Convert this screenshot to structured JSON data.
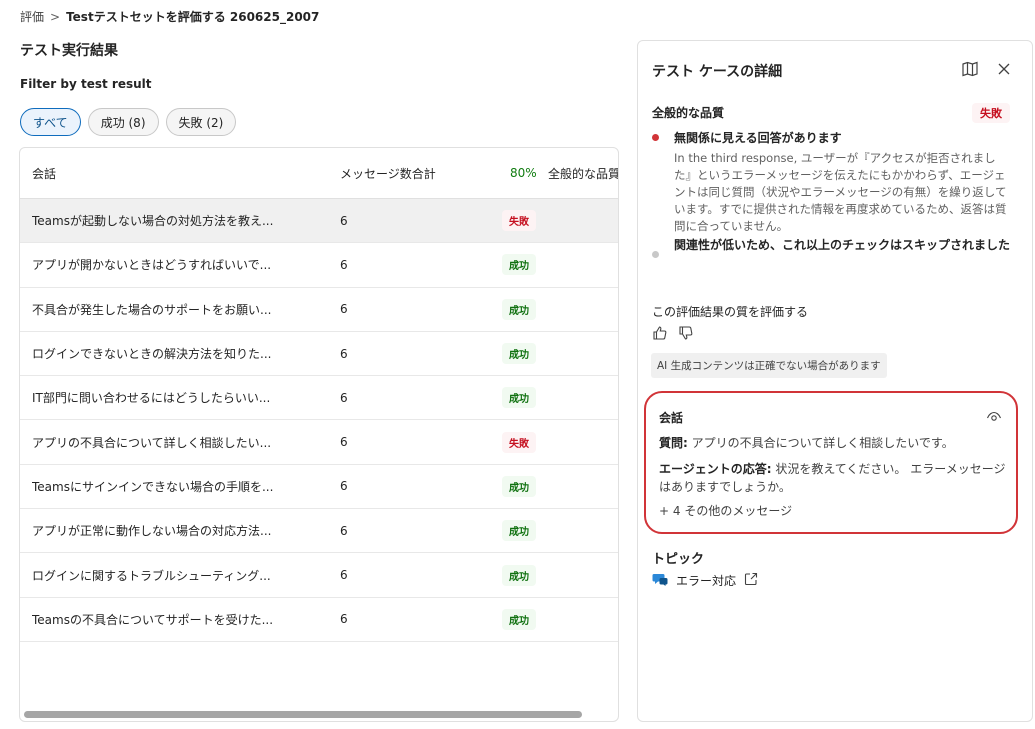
{
  "breadcrumb": {
    "parent": "評価",
    "separator": ">",
    "current": "Testテストセットを評価する 260625_2007"
  },
  "page_title": "テスト実行結果",
  "filter": {
    "label": "Filter by test result",
    "pills": [
      {
        "label": "すべて",
        "active": true
      },
      {
        "label": "成功 (8)",
        "active": false
      },
      {
        "label": "失敗 (2)",
        "active": false
      }
    ]
  },
  "table": {
    "headers": {
      "conversation": "会話",
      "messages": "メッセージ数合計",
      "percent": "80%",
      "quality": "全般的な品質"
    },
    "rows": [
      {
        "conversation": "Teamsが起動しない場合の対処方法を教え...",
        "messages": "6",
        "result": "失敗",
        "status": "fail"
      },
      {
        "conversation": "アプリが開かないときはどうすればいいで...",
        "messages": "6",
        "result": "成功",
        "status": "pass"
      },
      {
        "conversation": "不具合が発生した場合のサポートをお願い...",
        "messages": "6",
        "result": "成功",
        "status": "pass"
      },
      {
        "conversation": "ログインできないときの解決方法を知りた...",
        "messages": "6",
        "result": "成功",
        "status": "pass"
      },
      {
        "conversation": "IT部門に問い合わせるにはどうしたらいい...",
        "messages": "6",
        "result": "成功",
        "status": "pass"
      },
      {
        "conversation": "アプリの不具合について詳しく相談したい...",
        "messages": "6",
        "result": "失敗",
        "status": "fail"
      },
      {
        "conversation": "Teamsにサインインできない場合の手順を...",
        "messages": "6",
        "result": "成功",
        "status": "pass"
      },
      {
        "conversation": "アプリが正常に動作しない場合の対応方法...",
        "messages": "6",
        "result": "成功",
        "status": "pass"
      },
      {
        "conversation": "ログインに関するトラブルシューティング...",
        "messages": "6",
        "result": "成功",
        "status": "pass"
      },
      {
        "conversation": "Teamsの不具合についてサポートを受けた...",
        "messages": "6",
        "result": "成功",
        "status": "pass"
      }
    ]
  },
  "panel": {
    "title": "テスト ケースの詳細",
    "icons": [
      "map-icon",
      "close-icon"
    ],
    "quality_heading": "全般的な品質",
    "quality_result": "失敗",
    "issues": [
      {
        "title": "無関係に見える回答があります",
        "description": "In the third response, ユーザーが『アクセスが拒否されました』というエラーメッセージを伝えたにもかかわらず、エージェントは同じ質問（状況やエラーメッセージの有無）を繰り返しています。すでに提供された情報を再度求めているため、返答は質問に合っていません。",
        "color": "#d13438"
      },
      {
        "title": "関連性が低いため、これ以上のチェックはスキップされました",
        "description": "",
        "color": "#c8c8c8"
      }
    ],
    "rate_label": "この評価結果の質を評価する",
    "ai_note": "AI 生成コンテンツは正確でない場合があります",
    "conversation": {
      "title": "会話",
      "question_label": "質問:",
      "question": " アプリの不具合について詳しく相談したいです。",
      "answer_label": "エージェントの応答:",
      "answer": " 状況を教えてください。 エラーメッセージはありますでしょうか。",
      "more": "+ 4 その他のメッセージ"
    },
    "topic": {
      "heading": "トピック",
      "name": "エラー対応"
    }
  },
  "colors": {
    "accent": "#0f6cbd",
    "fail": "#c50f1f",
    "pass": "#0e700e",
    "highlight_border": "#d13438"
  }
}
